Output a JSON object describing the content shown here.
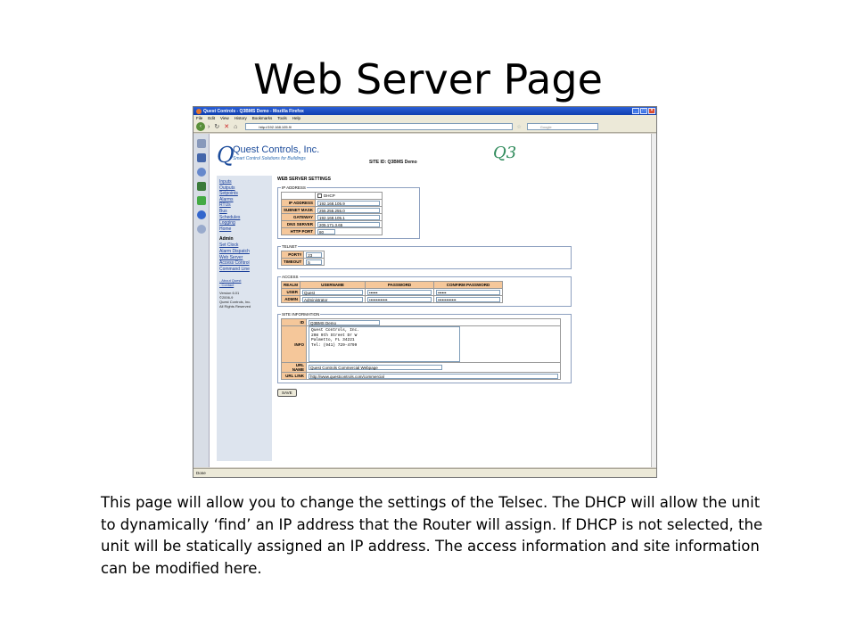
{
  "slide": {
    "title": "Web Server Page",
    "description": "This page will allow you to change the settings of the Telsec. The DHCP will allow the unit to dynamically ‘find’ an IP address that the Router will assign. If DHCP is not selected, the unit will be statically assigned an IP address. The access information and site information can be modified here."
  },
  "browser": {
    "window_title": "Quest Controls - Q3BMS Demo - Mozilla Firefox",
    "menu": [
      "File",
      "Edit",
      "View",
      "History",
      "Bookmarks",
      "Tools",
      "Help"
    ],
    "url": "http://192.168.105.9/",
    "search_placeholder": "Google",
    "status": "Done"
  },
  "site": {
    "company": "Quest Controls, Inc.",
    "tagline": "Smart Control Solutions for Buildings",
    "site_id_label": "SITE ID: Q3BMS Demo",
    "product_logo": "Q3"
  },
  "nav": {
    "links": [
      "Inputs",
      "Outputs",
      "Setpoints",
      "Alarms",
      "RTUs",
      "Bus",
      "Schedules",
      "Logging",
      "Home"
    ],
    "admin_heading": "Admin",
    "admin_links": [
      "Set Clock",
      "Alarm Dispatch",
      "Web Server",
      "Access Control",
      "Command Line"
    ],
    "about": "- About Quest",
    "contact": "- Contact",
    "version": "Version 6.01",
    "copyright_years": "©2006-9",
    "copyright_owner": "Quest Controls, Inc.",
    "rights": "All Rights Reserved"
  },
  "form": {
    "section_title": "WEB SERVER SETTINGS",
    "ip": {
      "legend": "IP ADDRESS",
      "dhcp_label": "DHCP",
      "rows": [
        {
          "label": "IP ADDRESS",
          "value": "192.168.105.9"
        },
        {
          "label": "SUBNET MASK",
          "value": "255.255.255.0"
        },
        {
          "label": "GATEWAY",
          "value": "192.168.105.1"
        },
        {
          "label": "DNS SERVER",
          "value": "205.171.3.65"
        },
        {
          "label": "HTTP PORT",
          "value": "80"
        }
      ]
    },
    "telnet": {
      "legend": "TELNET",
      "rows": [
        {
          "label": "PORT#",
          "value": "23"
        },
        {
          "label": "TIMEOUT",
          "value": "5"
        }
      ]
    },
    "access": {
      "legend": "ACCESS",
      "headers": [
        "REALM",
        "USERNAME",
        "PASSWORD",
        "CONFIRM PASSWORD"
      ],
      "rows": [
        {
          "realm": "USER",
          "username": "Quest",
          "password": "••••••",
          "confirm": "••••••"
        },
        {
          "realm": "ADMIN",
          "username": "Administrator",
          "password": "•••••••••••••",
          "confirm": "•••••••••••••"
        }
      ]
    },
    "site_info": {
      "legend": "SITE INFORMATION",
      "id_label": "ID",
      "id_value": "Q3BMS Demo",
      "info_label": "INFO",
      "info_value": "Quest Controls, Inc.\n208 9th Street Dr W\nPalmetto, FL 34221\nTel: (941) 729-4799",
      "url_name_label": "URL NAME",
      "url_name_value": "Quest Controls Commercial Webpage",
      "url_link_label": "URL LINK",
      "url_link_value": "http://www.questcontrols.com/commercial"
    },
    "save_label": "SAVE"
  }
}
